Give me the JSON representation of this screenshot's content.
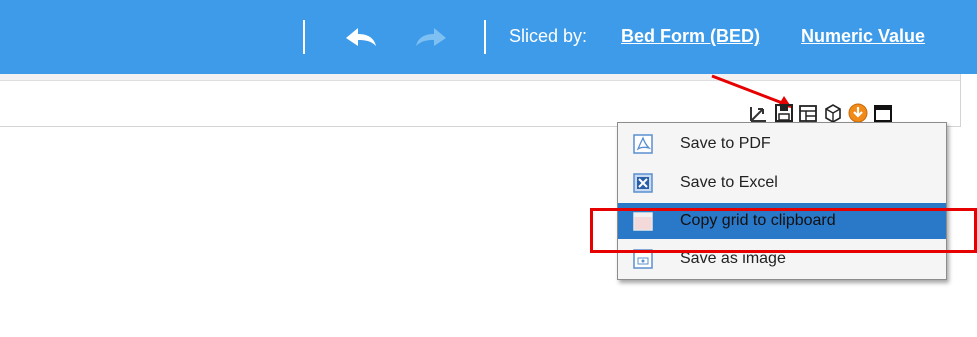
{
  "topbar": {
    "sliced_by_label": "Sliced by:",
    "slice_links": [
      "Bed Form (BED)",
      "Numeric Value"
    ],
    "undo_icon": "undo-arrow-icon",
    "redo_icon": "redo-arrow-icon"
  },
  "toolbar": {
    "icons": [
      "axis-swap-icon",
      "save-floppy-icon",
      "grid-layout-icon",
      "3d-cube-icon",
      "download-circle-icon",
      "window-maximize-icon"
    ]
  },
  "save_menu": {
    "items": [
      {
        "label": "Save to PDF",
        "icon": "pdf-icon"
      },
      {
        "label": "Save to Excel",
        "icon": "excel-icon"
      },
      {
        "label": "Copy grid to clipboard",
        "icon": "clipboard-icon",
        "selected": true
      },
      {
        "label": "Save as image",
        "icon": "image-icon"
      }
    ]
  },
  "colors": {
    "topbar_bg": "#3d9be9",
    "menu_selected_bg": "#2a78c8",
    "annotation_red": "#e60000"
  }
}
